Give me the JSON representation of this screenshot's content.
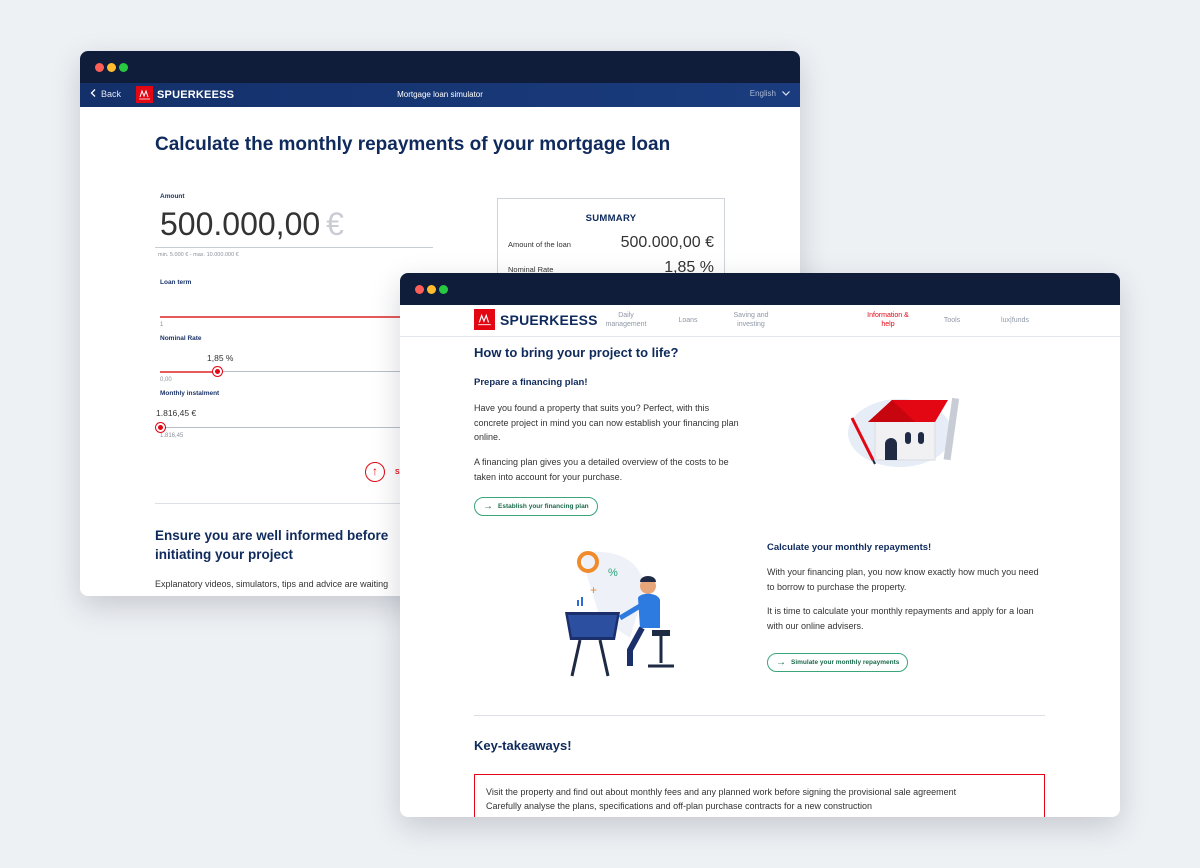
{
  "window1": {
    "nav": {
      "back_label": "Back",
      "brand": "SPUERKEESS",
      "title": "Mortgage loan simulator",
      "language": "English"
    },
    "page_title": "Calculate the monthly repayments of your mortgage loan",
    "amount": {
      "label": "Amount",
      "value": "500.000,00",
      "currency": "€",
      "hint": "min. 5.000 € - max. 10.000.000 €"
    },
    "loan_term": {
      "label": "Loan term",
      "min_label": "1",
      "level": 0.0
    },
    "nominal_rate": {
      "label": "Nominal Rate",
      "value": "1,85 %",
      "min_label": "0,00",
      "level": 0.24
    },
    "monthly_instalment": {
      "label": "Monthly instalment",
      "value": "1.816,45 €",
      "min_label": "1.816,45",
      "level": 0.0
    },
    "scroll_partial_label": "S",
    "summary": {
      "heading": "SUMMARY",
      "rows": [
        {
          "label": "Amount of the loan",
          "value": "500.000,00 €"
        },
        {
          "label": "Nominal Rate",
          "value": "1,85 %"
        }
      ]
    },
    "section_title": "Ensure you are well informed before initiating your project",
    "section_text": "Explanatory videos, simulators, tips and advice are waiting"
  },
  "window2": {
    "nav": {
      "brand": "SPUERKEESS",
      "items": [
        {
          "label": "Daily management"
        },
        {
          "label": "Loans"
        },
        {
          "label": "Saving and investing"
        },
        {
          "label": "Information & help",
          "active": true
        },
        {
          "label": "Tools"
        },
        {
          "label": "lux|funds"
        }
      ]
    },
    "section_title": "How to bring your project to life?",
    "plan": {
      "title": "Prepare a financing plan!",
      "p1": "Have you found a property that suits you? Perfect, with this concrete project in mind you can now establish your financing plan online.",
      "p2": "A financing plan gives you a detailed overview of the costs to be taken into account for your purchase.",
      "button": "Establish your financing plan"
    },
    "repay": {
      "title": "Calculate your monthly repayments!",
      "p1": "With your financing plan, you now know exactly how much you need to borrow to purchase the property.",
      "p2": "It is time to calculate your monthly repayments and apply for a loan with our online advisers.",
      "button": "Simulate your monthly repayments"
    },
    "takeaways": {
      "title": "Key-takeaways!",
      "items": [
        "Visit the property and find out about monthly fees and any planned work before signing the provisional sale agreement",
        "Carefully analyse the plans, specifications and off-plan purchase contracts for a new construction"
      ]
    }
  },
  "colors": {
    "brand_red": "#e30613",
    "navy": "#0f2a5c",
    "accent_green": "#3aa57a"
  }
}
